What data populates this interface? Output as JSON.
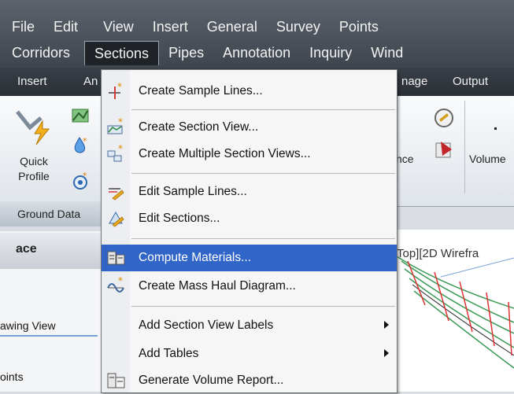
{
  "menubar": {
    "row1": [
      "File",
      "Edit",
      "View",
      "Insert",
      "General",
      "Survey",
      "Points"
    ],
    "row2": [
      "Corridors",
      "Sections",
      "Pipes",
      "Annotation",
      "Inquiry",
      "Wind"
    ]
  },
  "tabs": [
    "Insert",
    "An",
    "nage",
    "Output"
  ],
  "ribbon": {
    "quick_profile": "Quick\nProfile",
    "quick_profile_l1": "Quick",
    "quick_profile_l2": "Profile",
    "nce": "nce",
    "volume": "Volume",
    "ground_data": "Ground Data"
  },
  "left_panel": {
    "header": "ace",
    "row1": "awing View",
    "row2": "oints"
  },
  "viewport_label": "Top][2D Wirefra",
  "dropdown": {
    "items": [
      {
        "label": "Create Sample Lines...",
        "icon": "sample-lines-icon"
      },
      {
        "label": "Create Section View...",
        "icon": "section-view-icon"
      },
      {
        "label": "Create Multiple Section Views...",
        "icon": "multiple-section-views-icon"
      },
      {
        "label": "Edit Sample Lines...",
        "icon": "edit-sample-lines-icon"
      },
      {
        "label": "Edit Sections...",
        "icon": "edit-sections-icon"
      },
      {
        "label": "Compute Materials...",
        "icon": "compute-materials-icon"
      },
      {
        "label": "Create Mass Haul Diagram...",
        "icon": "mass-haul-icon"
      },
      {
        "label": "Add Section View Labels",
        "icon": ""
      },
      {
        "label": "Add Tables",
        "icon": ""
      },
      {
        "label": "Generate Volume Report...",
        "icon": "volume-report-icon"
      }
    ]
  },
  "colors": {
    "highlight": "#3165c8",
    "menubar": "#4a5058"
  }
}
